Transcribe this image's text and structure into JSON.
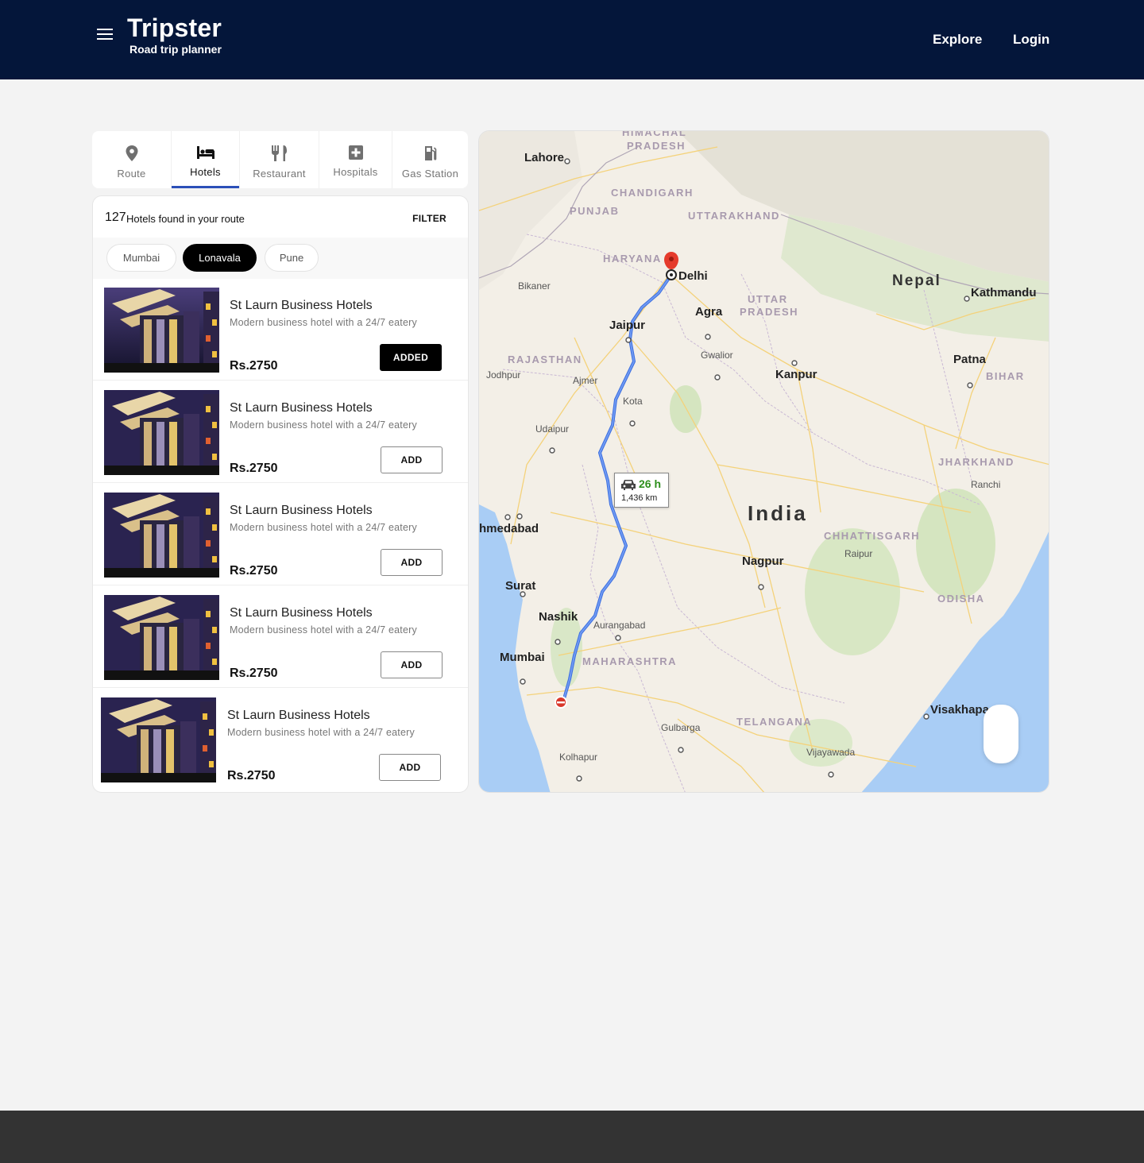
{
  "header": {
    "brand_title": "Tripster",
    "brand_subtitle": "Road trip planner",
    "nav": [
      "Explore",
      "Login"
    ]
  },
  "tabs": [
    {
      "label": "Route",
      "icon": "map-pin-icon",
      "active": false
    },
    {
      "label": "Hotels",
      "icon": "bed-icon",
      "active": true
    },
    {
      "label": "Restaurant",
      "icon": "fork-knife-icon",
      "active": false
    },
    {
      "label": "Hospitals",
      "icon": "medical-cross-icon",
      "active": false
    },
    {
      "label": "Gas Station",
      "icon": "fuel-pump-icon",
      "active": false
    }
  ],
  "results": {
    "count": "127",
    "count_label": "Hotels found in your route",
    "filter_label": "FILTER",
    "cities": [
      "Mumbai",
      "Lonavala",
      "Pune"
    ],
    "active_city": "Lonavala"
  },
  "hotels": [
    {
      "name": "St Laurn Business Hotels",
      "description": "Modern business hotel with a 24/7 eatery",
      "price": "Rs.2750",
      "action": "ADDED"
    },
    {
      "name": "St Laurn Business Hotels",
      "description": "Modern business hotel with a 24/7 eatery",
      "price": "Rs.2750",
      "action": "ADD"
    },
    {
      "name": "St Laurn Business Hotels",
      "description": "Modern business hotel with a 24/7 eatery",
      "price": "Rs.2750",
      "action": "ADD"
    },
    {
      "name": "St Laurn Business Hotels",
      "description": "Modern business hotel with a 24/7 eatery",
      "price": "Rs.2750",
      "action": "ADD"
    },
    {
      "name": "St Laurn Business Hotels",
      "description": "Modern business hotel with a 24/7 eatery",
      "price": "Rs.2750",
      "action": "ADD"
    }
  ],
  "map": {
    "route_duration": "26 h",
    "route_distance": "1,436 km",
    "labels": {
      "delhi": "Delhi",
      "india": "India",
      "nepal": "Nepal",
      "jaipur": "Jaipur",
      "agra": "Agra",
      "mumbai": "Mumbai",
      "nashik": "Nashik",
      "surat": "Surat",
      "ahmedabad": "hmedabad",
      "nagpur": "Nagpur",
      "kanpur": "Kanpur",
      "patna": "Patna",
      "kathmandu": "Kathmandu",
      "lahore": "Lahore",
      "kota": "Kota",
      "udaipur": "Udaipur",
      "jodhpur": "Jodhpur",
      "ajmer": "Ajmer",
      "bikaner": "Bikaner",
      "gwalior": "Gwalior",
      "aurangabad": "Aurangabad",
      "kolhapur": "Kolhapur",
      "gulbarga": "Gulbarga",
      "raipur": "Raipur",
      "ranchi": "Ranchi",
      "vijayawada": "Vijayawada",
      "visakhapatnam": "Visakhapa",
      "rajasthan": "RAJASTHAN",
      "maharashtra": "MAHARASHTRA",
      "telangana": "TELANGANA",
      "chhattisgarh": "CHHATTISGARH",
      "jharkhand": "JHARKHAND",
      "odisha": "ODISHA",
      "punjab": "PUNJAB",
      "haryana": "HARYANA",
      "uttarakhand": "UTTARAKHAND",
      "uttar": "UTTAR",
      "pradesh": "PRADESH",
      "bihar": "BIHAR",
      "chandigarh": "CHANDIGARH",
      "himachal": "HIMACHAL",
      "himachal_pradesh": "PRADESH"
    }
  },
  "colors": {
    "header_bg": "#04163a",
    "tab_accent": "#2b50b8",
    "route_blue": "#4a7be8",
    "water": "#a9cdf5",
    "footer_bg": "#333333"
  }
}
